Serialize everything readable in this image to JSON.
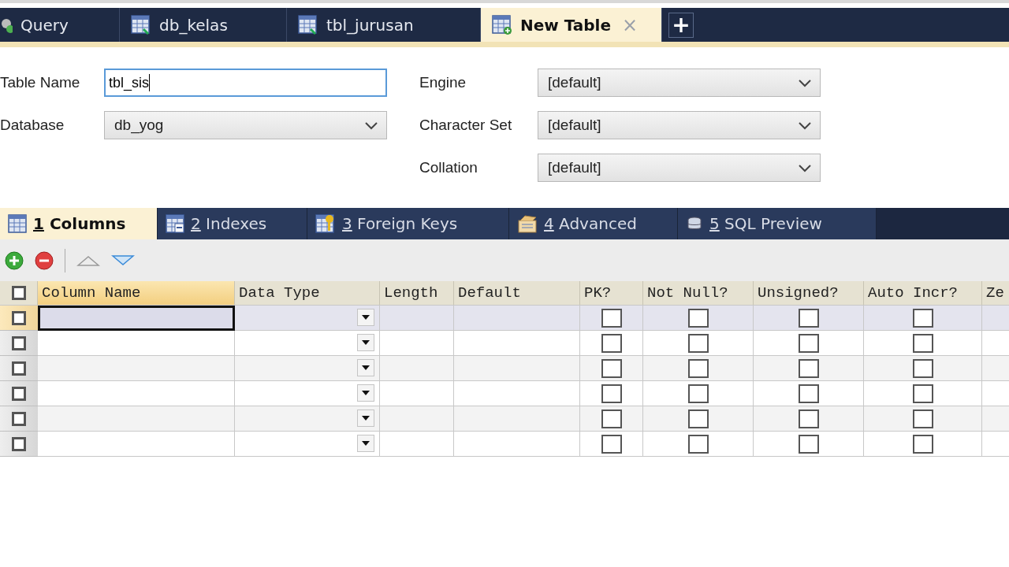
{
  "tabs": [
    {
      "label": "Query",
      "kind": "query",
      "selected": false
    },
    {
      "label": "db_kelas",
      "kind": "table",
      "selected": false
    },
    {
      "label": "tbl_jurusan",
      "kind": "table",
      "selected": false
    },
    {
      "label": "New Table",
      "kind": "new-table",
      "selected": true,
      "close": "×"
    }
  ],
  "new_tab_button": "+",
  "form": {
    "left": [
      {
        "label": "Table Name",
        "kind": "input",
        "value": "tbl_sis",
        "focused": true
      },
      {
        "label": "Database",
        "kind": "select",
        "value": "db_yog"
      }
    ],
    "right": [
      {
        "label": "Engine",
        "kind": "select",
        "value": "[default]"
      },
      {
        "label": "Character Set",
        "kind": "select",
        "value": "[default]"
      },
      {
        "label": "Collation",
        "kind": "select",
        "value": "[default]"
      }
    ]
  },
  "subtabs": [
    {
      "number": "1",
      "label": "Columns",
      "kind": "columns",
      "selected": true
    },
    {
      "number": "2",
      "label": "Indexes",
      "kind": "indexes",
      "selected": false
    },
    {
      "number": "3",
      "label": "Foreign Keys",
      "kind": "keys",
      "selected": false
    },
    {
      "number": "4",
      "label": "Advanced",
      "kind": "advanced",
      "selected": false
    },
    {
      "number": "5",
      "label": "SQL Preview",
      "kind": "sql",
      "selected": false
    }
  ],
  "grid": {
    "all_checked": false,
    "columns": [
      {
        "label": "Column Name",
        "kind": "text",
        "selected": true
      },
      {
        "label": "Data Type",
        "kind": "type",
        "selected": false
      },
      {
        "label": "Length",
        "kind": "text",
        "selected": false
      },
      {
        "label": "Default",
        "kind": "text",
        "selected": false
      },
      {
        "label": "PK?",
        "kind": "check",
        "selected": false
      },
      {
        "label": "Not Null?",
        "kind": "check",
        "selected": false
      },
      {
        "label": "Unsigned?",
        "kind": "check",
        "selected": false
      },
      {
        "label": "Auto Incr?",
        "kind": "check",
        "selected": false
      },
      {
        "label": "Ze",
        "kind": "cut",
        "selected": false
      }
    ],
    "rows": [
      {
        "selected": true,
        "checked": false,
        "flags": [
          false,
          false,
          false,
          false
        ]
      },
      {
        "selected": false,
        "checked": false,
        "flags": [
          false,
          false,
          false,
          false
        ]
      },
      {
        "selected": false,
        "checked": false,
        "flags": [
          false,
          false,
          false,
          false
        ]
      },
      {
        "selected": false,
        "checked": false,
        "flags": [
          false,
          false,
          false,
          false
        ]
      },
      {
        "selected": false,
        "checked": false,
        "flags": [
          false,
          false,
          false,
          false
        ]
      },
      {
        "selected": false,
        "checked": false,
        "flags": [
          false,
          false,
          false,
          false
        ]
      }
    ]
  }
}
